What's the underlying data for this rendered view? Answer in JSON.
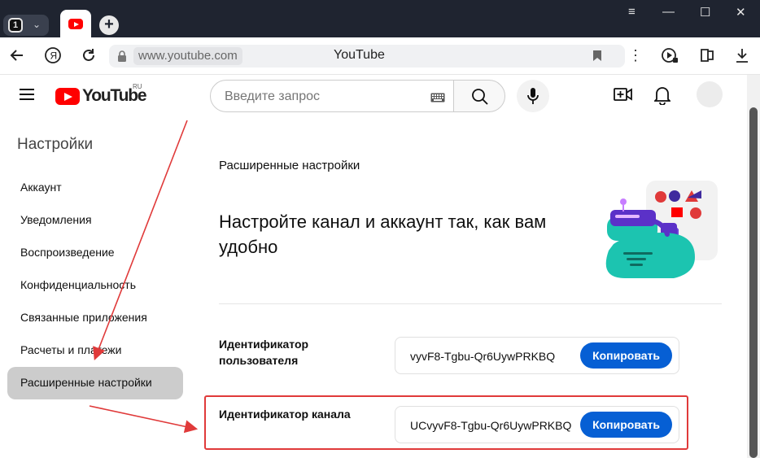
{
  "browser": {
    "tab_count": "1",
    "address_host": "www.youtube.com",
    "page_title": "YouTube",
    "window_controls": [
      "≡",
      "—",
      "☐",
      "✕"
    ]
  },
  "header": {
    "logo_text": "YouTube",
    "logo_region": "RU",
    "search_placeholder": "Введите запрос"
  },
  "sidebar": {
    "title": "Настройки",
    "items": [
      {
        "label": "Аккаунт"
      },
      {
        "label": "Уведомления"
      },
      {
        "label": "Воспроизведение"
      },
      {
        "label": "Конфиденциальность"
      },
      {
        "label": "Связанные приложения"
      },
      {
        "label": "Расчеты и платежи"
      },
      {
        "label": "Расширенные настройки",
        "active": true
      }
    ]
  },
  "main": {
    "section_title": "Расширенные настройки",
    "headline": "Настройте канал и аккаунт так, как вам удобно",
    "user_id": {
      "label": "Идентификатор пользователя",
      "value": "vyvF8-Tgbu-Qr6UywPRKBQ",
      "button": "Копировать"
    },
    "channel_id": {
      "label": "Идентификатор канала",
      "value": "UCvyvF8-Tgbu-Qr6UywPRKBQ",
      "button": "Копировать"
    }
  },
  "colors": {
    "accent_blue": "#065fd4",
    "annotation_red": "#e03a3a",
    "youtube_red": "#ff0000"
  }
}
